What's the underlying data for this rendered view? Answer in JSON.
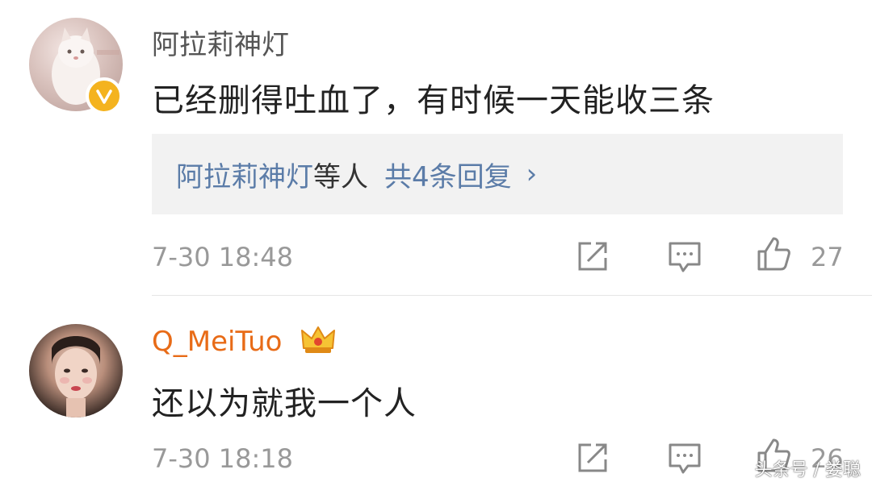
{
  "comments": [
    {
      "username": "阿拉莉神灯",
      "text": "已经删得吐血了，有时候一天能收三条",
      "avatar": "cat-avatar",
      "verified": true,
      "replies": {
        "names": "阿拉莉神灯",
        "suffix": "等人",
        "count_label": "共4条回复",
        "chevron": "›"
      },
      "timestamp": "7-30 18:48",
      "likes": "27",
      "icons": [
        "share-icon",
        "comment-icon",
        "like-icon"
      ]
    },
    {
      "username": "Q_MeiTuo",
      "text": "还以为就我一个人",
      "avatar": "woman-avatar",
      "badge": "crown-icon",
      "timestamp": "7-30 18:18",
      "likes": "26",
      "icons": [
        "share-icon",
        "comment-icon",
        "like-icon"
      ]
    }
  ],
  "watermark": "头条号 / 娄聪",
  "colors": {
    "username_vip": "#e86b17",
    "link_blue": "#5b7ca8",
    "verified_badge": "#f4b31f"
  }
}
